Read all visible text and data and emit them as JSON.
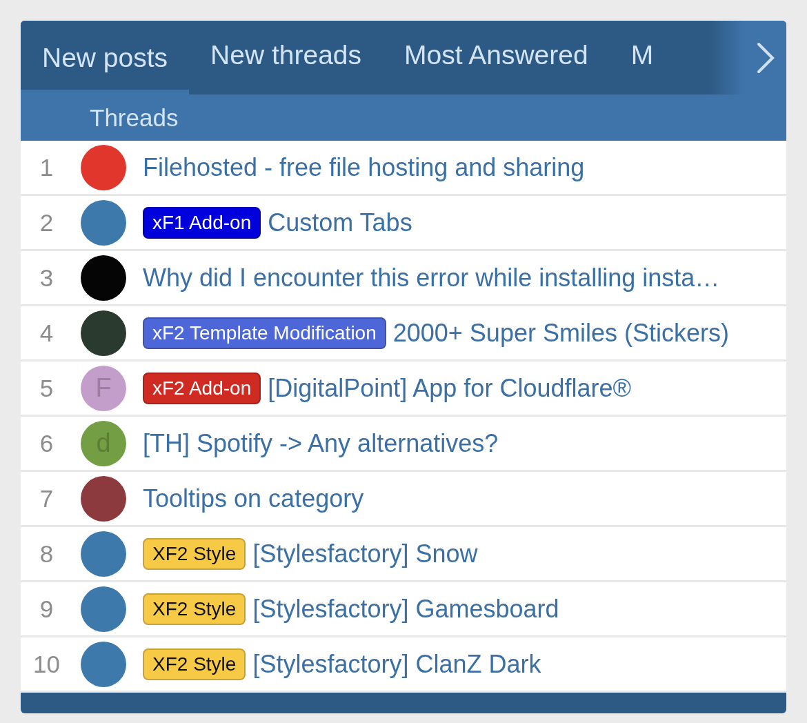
{
  "tabs": [
    {
      "label": "New posts",
      "selected": true
    },
    {
      "label": "New threads",
      "selected": false
    },
    {
      "label": "Most Answered",
      "selected": false
    },
    {
      "label": "M",
      "selected": false
    }
  ],
  "sub_tab": "Threads",
  "rows": [
    {
      "number": "1",
      "avatar": {
        "kind": "image",
        "color": "#e0362b"
      },
      "title": "Filehosted - free file hosting and sharing"
    },
    {
      "number": "2",
      "avatar": {
        "kind": "image",
        "color": "#3d7aab"
      },
      "prefix": {
        "label": "xF1 Add-on",
        "color": "#0000dd"
      },
      "title": "Custom Tabs"
    },
    {
      "number": "3",
      "avatar": {
        "kind": "image",
        "color": "#050505"
      },
      "title": "Why did I encounter this error while installing insta…"
    },
    {
      "number": "4",
      "avatar": {
        "kind": "image",
        "color": "#2b3a2f"
      },
      "prefix": {
        "label": "xF2 Template Modification",
        "color": "#4d67d8"
      },
      "title": "2000+ Super Smiles (Stickers)"
    },
    {
      "number": "5",
      "avatar": {
        "kind": "letter",
        "letter": "F",
        "color": "#c49ecb"
      },
      "prefix": {
        "label": "xF2 Add-on",
        "color": "#d02b22"
      },
      "title": "[DigitalPoint] App for Cloudflare®"
    },
    {
      "number": "6",
      "avatar": {
        "kind": "letter",
        "letter": "d",
        "color": "#739e43"
      },
      "title": "[TH] Spotify -> Any alternatives?"
    },
    {
      "number": "7",
      "avatar": {
        "kind": "image",
        "color": "#8c3a3e"
      },
      "title": "Tooltips on category"
    },
    {
      "number": "8",
      "avatar": {
        "kind": "image",
        "color": "#3d7aab"
      },
      "prefix": {
        "label": "XF2 Style",
        "color": "#f7ca45"
      },
      "title": "[Stylesfactory] Snow"
    },
    {
      "number": "9",
      "avatar": {
        "kind": "image",
        "color": "#3d7aab"
      },
      "prefix": {
        "label": "XF2 Style",
        "color": "#f7ca45"
      },
      "title": "[Stylesfactory] Gamesboard"
    },
    {
      "number": "10",
      "avatar": {
        "kind": "image",
        "color": "#3d7aab"
      },
      "prefix": {
        "label": "XF2 Style",
        "color": "#f7ca45"
      },
      "title": "[Stylesfactory] ClanZ Dark"
    }
  ]
}
